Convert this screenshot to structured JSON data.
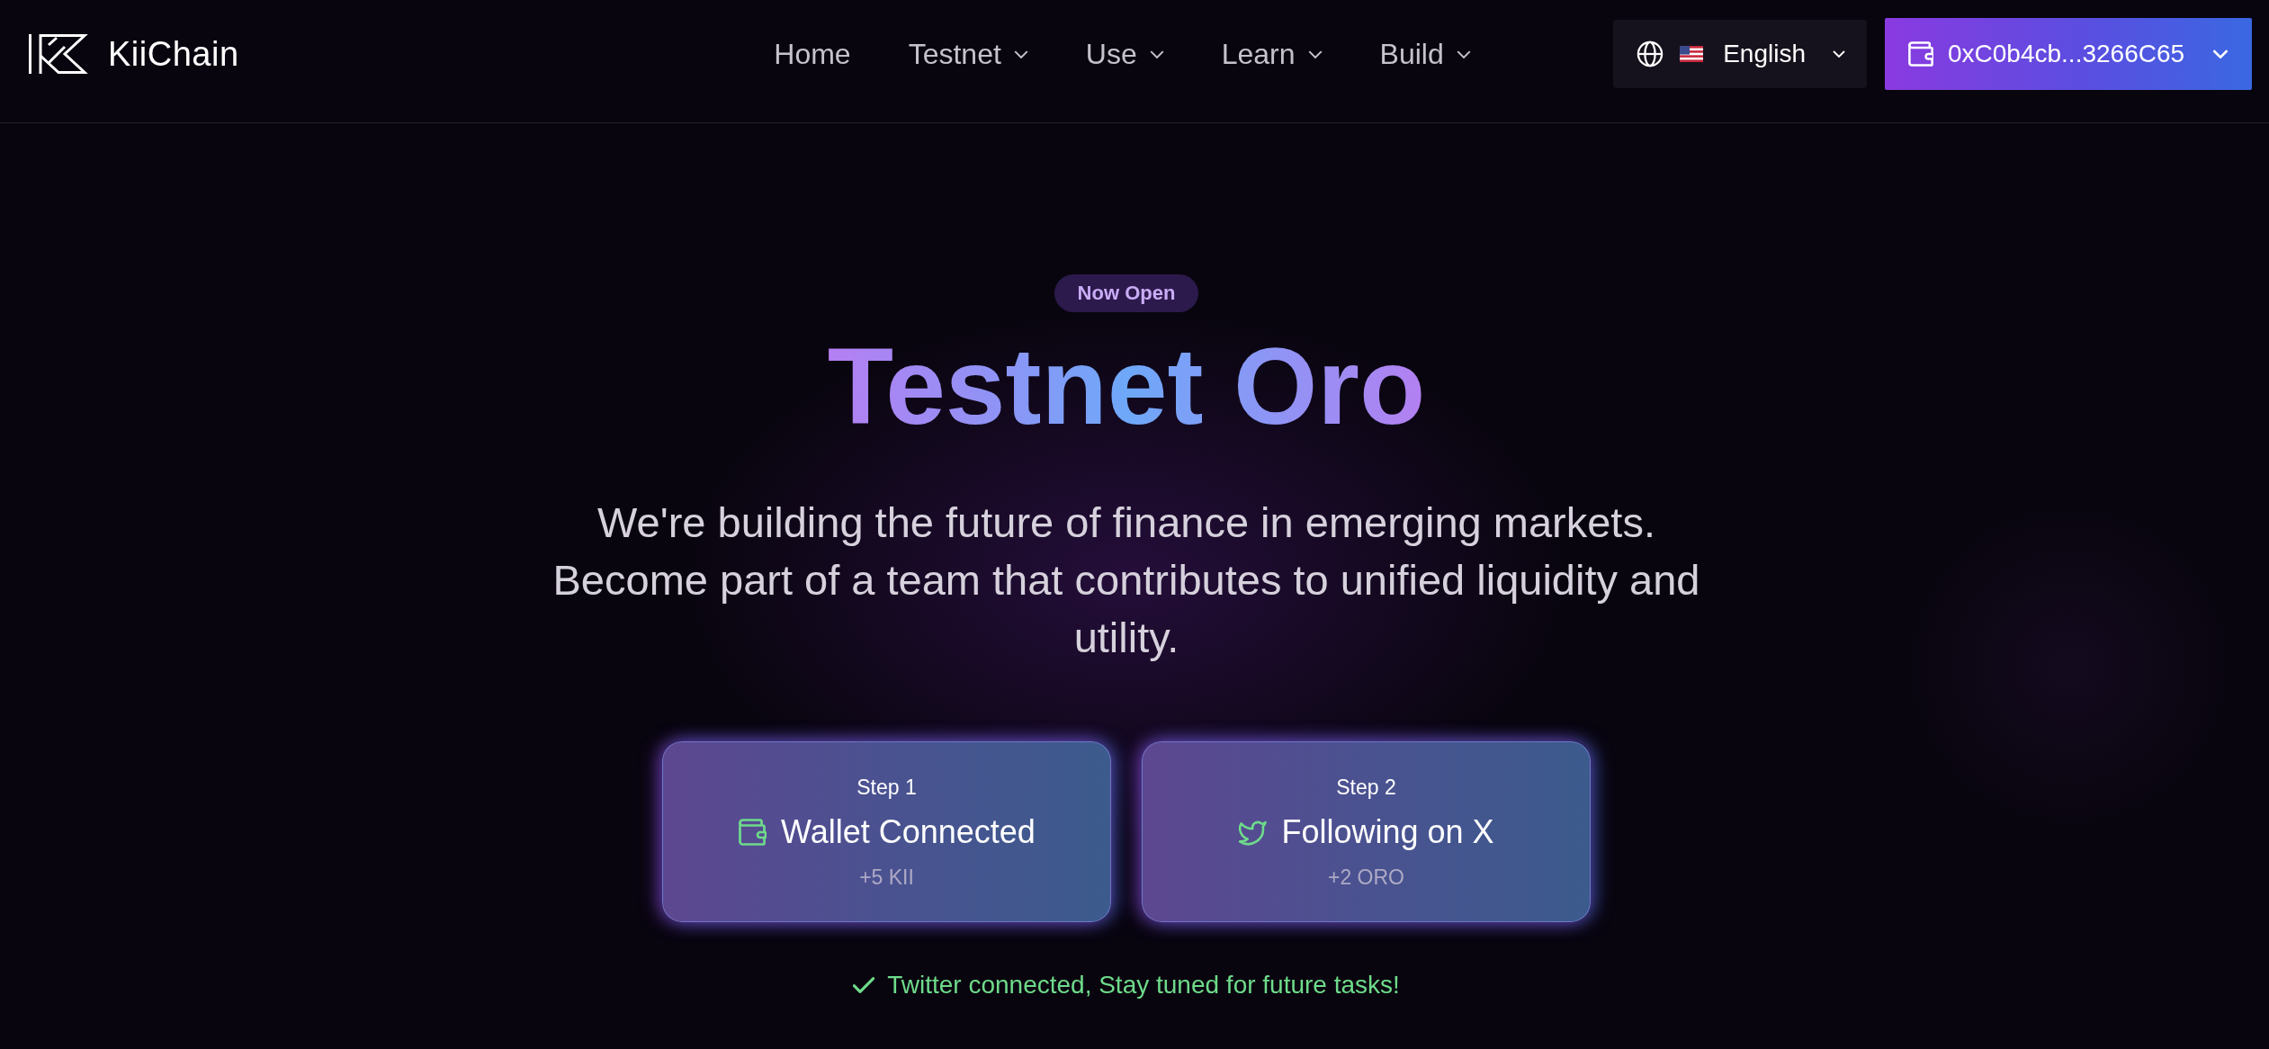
{
  "header": {
    "logo": {
      "text": "KiiChain"
    },
    "nav": [
      {
        "label": "Home",
        "has_menu": false
      },
      {
        "label": "Testnet",
        "has_menu": true
      },
      {
        "label": "Use",
        "has_menu": true
      },
      {
        "label": "Learn",
        "has_menu": true
      },
      {
        "label": "Build",
        "has_menu": true
      }
    ],
    "language": {
      "label": "English"
    },
    "wallet": {
      "address": "0xC0b4cb...3266C65"
    }
  },
  "hero": {
    "badge": "Now Open",
    "title": "Testnet Oro",
    "description": "We're building the future of finance in emerging markets. Become part of a team that contributes to unified liquidity and utility."
  },
  "steps": [
    {
      "kind": "wallet",
      "step": "Step 1",
      "title": "Wallet Connected",
      "reward": "+5 KII",
      "completed": true
    },
    {
      "kind": "twitter",
      "step": "Step 2",
      "title": "Following on X",
      "reward": "+2 ORO",
      "completed": true
    }
  ],
  "status_message": {
    "text": "Twitter connected, Stay tuned for future tasks!"
  }
}
